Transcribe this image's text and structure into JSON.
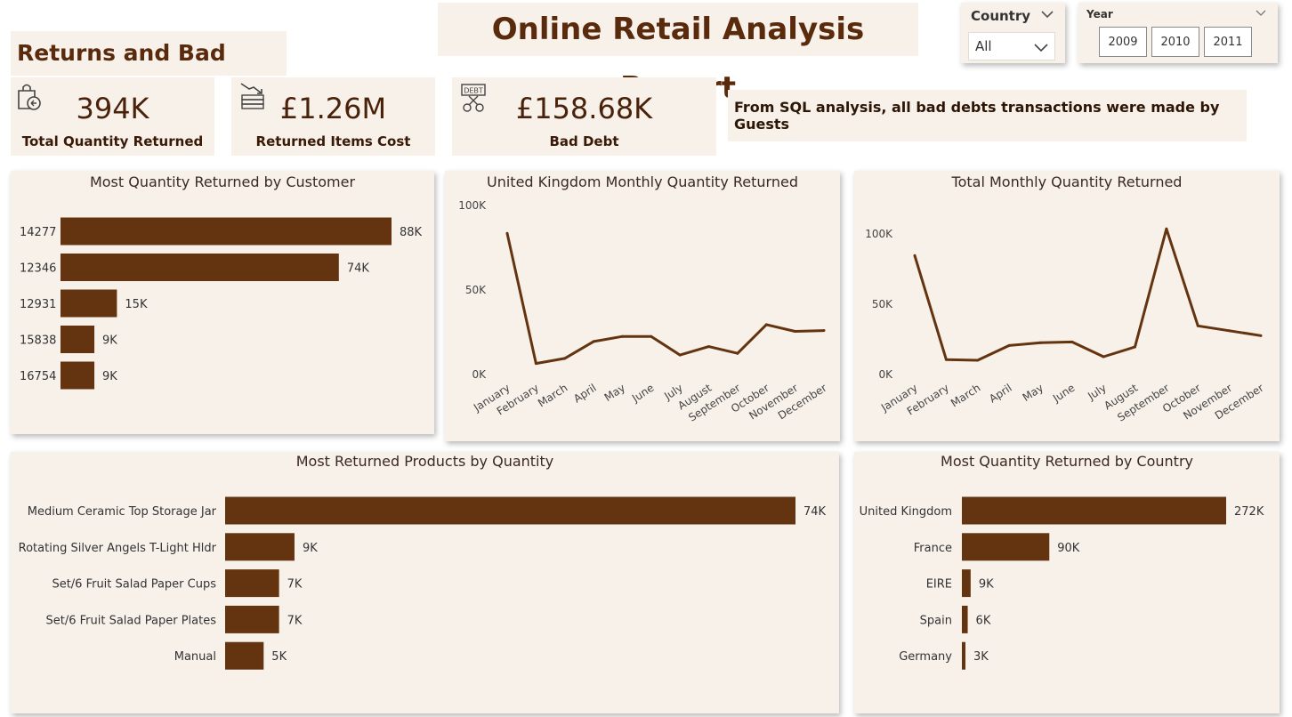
{
  "report_title": "Online Retail Analysis Report",
  "section_title": "Returns and Bad Debt",
  "filters": {
    "country_label": "Country",
    "country_value": "All",
    "year_label": "Year",
    "years": [
      "2009",
      "2010",
      "2011"
    ]
  },
  "kpis": [
    {
      "value": "394K",
      "label": "Total Quantity Returned",
      "icon": "shopping-bag-refund-icon"
    },
    {
      "value": "£1.26M",
      "label": "Returned Items Cost",
      "icon": "stacked-bills-down-icon"
    },
    {
      "value": "£158.68K",
      "label": "Bad Debt",
      "icon": "debt-scissors-icon"
    }
  ],
  "note": "From SQL analysis, all bad debts transactions were made by Guests",
  "colors": {
    "bar": "#63340f",
    "background": "#f7f1ea",
    "title": "#5a2a0c"
  },
  "chart_data": [
    {
      "id": "by_customer",
      "type": "bar",
      "orientation": "horizontal",
      "title": "Most Quantity Returned by Customer",
      "categories": [
        "14277",
        "12346",
        "12931",
        "15838",
        "16754"
      ],
      "values": [
        88000,
        74000,
        15000,
        9000,
        9000
      ],
      "labels": [
        "88K",
        "74K",
        "15K",
        "9K",
        "9K"
      ]
    },
    {
      "id": "uk_monthly",
      "type": "line",
      "title": "United Kingdom Monthly Quantity Returned",
      "x": [
        "January",
        "February",
        "March",
        "April",
        "May",
        "June",
        "July",
        "August",
        "September",
        "October",
        "November",
        "December"
      ],
      "values": [
        83000,
        6000,
        9000,
        19000,
        22000,
        22000,
        11000,
        16000,
        12000,
        29000,
        25000,
        25500
      ],
      "ylim": [
        0,
        100000
      ],
      "ticks": [
        {
          "v": 0,
          "t": "0K"
        },
        {
          "v": 50000,
          "t": "50K"
        },
        {
          "v": 100000,
          "t": "100K"
        }
      ]
    },
    {
      "id": "total_monthly",
      "type": "line",
      "title": "Total Monthly Quantity Returned",
      "x": [
        "January",
        "February",
        "March",
        "April",
        "May",
        "June",
        "July",
        "August",
        "September",
        "October",
        "November",
        "December"
      ],
      "values": [
        84000,
        10000,
        9500,
        20000,
        22000,
        22500,
        12000,
        19000,
        103000,
        34000,
        30500,
        27000
      ],
      "ylim": [
        0,
        100000
      ],
      "ticks": [
        {
          "v": 0,
          "t": "0K"
        },
        {
          "v": 50000,
          "t": "50K"
        },
        {
          "v": 100000,
          "t": "100K"
        }
      ]
    },
    {
      "id": "by_product",
      "type": "bar",
      "orientation": "horizontal",
      "title": "Most Returned Products by Quantity",
      "categories": [
        "Medium Ceramic Top Storage Jar",
        "Rotating Silver Angels T-Light Hldr",
        "Set/6 Fruit Salad Paper Cups",
        "Set/6 Fruit Salad Paper Plates",
        "Manual"
      ],
      "values": [
        74000,
        9000,
        7000,
        7000,
        5000
      ],
      "labels": [
        "74K",
        "9K",
        "7K",
        "7K",
        "5K"
      ]
    },
    {
      "id": "by_country",
      "type": "bar",
      "orientation": "horizontal",
      "title": "Most Quantity Returned by Country",
      "categories": [
        "United Kingdom",
        "France",
        "EIRE",
        "Spain",
        "Germany"
      ],
      "values": [
        272000,
        90000,
        9000,
        6000,
        3000
      ],
      "labels": [
        "272K",
        "90K",
        "9K",
        "6K",
        "3K"
      ]
    }
  ]
}
